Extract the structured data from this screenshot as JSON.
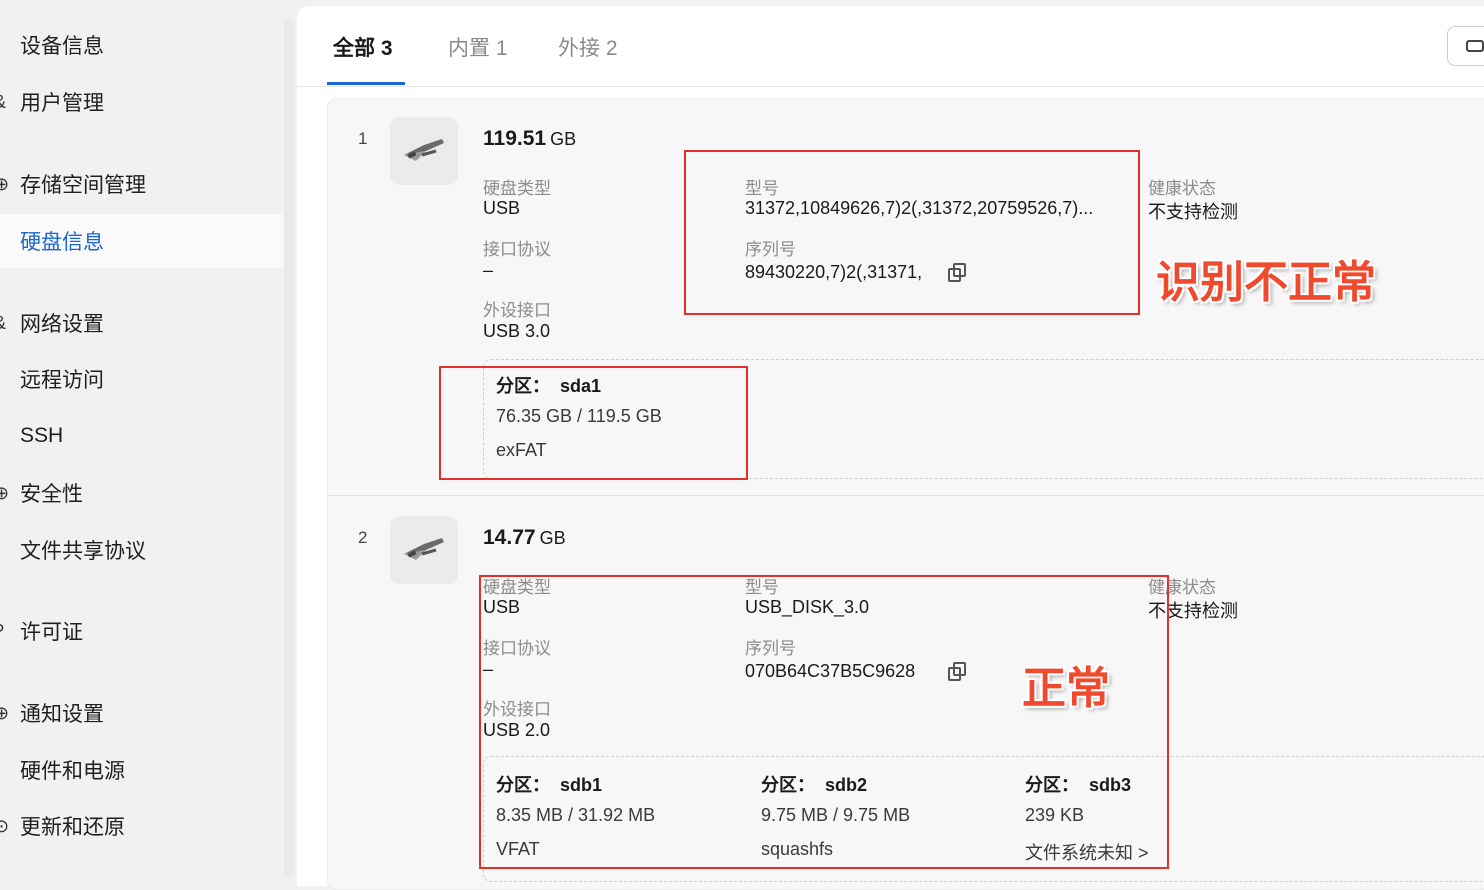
{
  "sidebar": {
    "items": [
      {
        "label": "设备信息",
        "edge": ""
      },
      {
        "label": "用户管理",
        "edge": "&"
      },
      {
        "label": "存储空间管理",
        "edge": "⊕"
      },
      {
        "label": "硬盘信息",
        "edge": ""
      },
      {
        "label": "网络设置",
        "edge": "&"
      },
      {
        "label": "远程访问",
        "edge": "/"
      },
      {
        "label": "SSH",
        "edge": ""
      },
      {
        "label": "安全性",
        "edge": "⊕"
      },
      {
        "label": "文件共享协议",
        "edge": ""
      },
      {
        "label": "许可证",
        "edge": "?"
      },
      {
        "label": "通知设置",
        "edge": "⊕"
      },
      {
        "label": "硬件和电源",
        "edge": "·"
      },
      {
        "label": "更新和还原",
        "edge": "⊙"
      }
    ]
  },
  "tabs": [
    {
      "label": "全部 3"
    },
    {
      "label": "内置 1"
    },
    {
      "label": "外接 2"
    }
  ],
  "labels": {
    "type": "硬盘类型",
    "protocol": "接口协议",
    "port": "外设接口",
    "model": "型号",
    "serial": "序列号",
    "health": "健康状态",
    "partition": "分区："
  },
  "disks": [
    {
      "index": "1",
      "capacity": "119.51",
      "unit": "GB",
      "type": "USB",
      "protocol": "–",
      "port": "USB 3.0",
      "model": "31372,10849626,7)2(,31372,20759526,7)...",
      "serial": "89430220,7)2(,31371,",
      "health": "不支持检测",
      "partitions": [
        {
          "name": "sda1",
          "usage": "76.35 GB / 119.5 GB",
          "fs": "exFAT"
        }
      ]
    },
    {
      "index": "2",
      "capacity": "14.77",
      "unit": "GB",
      "type": "USB",
      "protocol": "–",
      "port": "USB 2.0",
      "model": "USB_DISK_3.0",
      "serial": "070B64C37B5C9628",
      "health": "不支持检测",
      "partitions": [
        {
          "name": "sdb1",
          "usage": "8.35 MB / 31.92 MB",
          "fs": "VFAT"
        },
        {
          "name": "sdb2",
          "usage": "9.75 MB / 9.75 MB",
          "fs": "squashfs"
        },
        {
          "name": "sdb3",
          "usage": "239 KB",
          "fs": "文件系统未知 >"
        }
      ]
    }
  ],
  "annotations": {
    "abnormal": "识别不正常",
    "normal": "正常",
    "color": "#e0322a"
  },
  "colors": {
    "accent": "#1967d2",
    "annotation": "#e0322a"
  }
}
